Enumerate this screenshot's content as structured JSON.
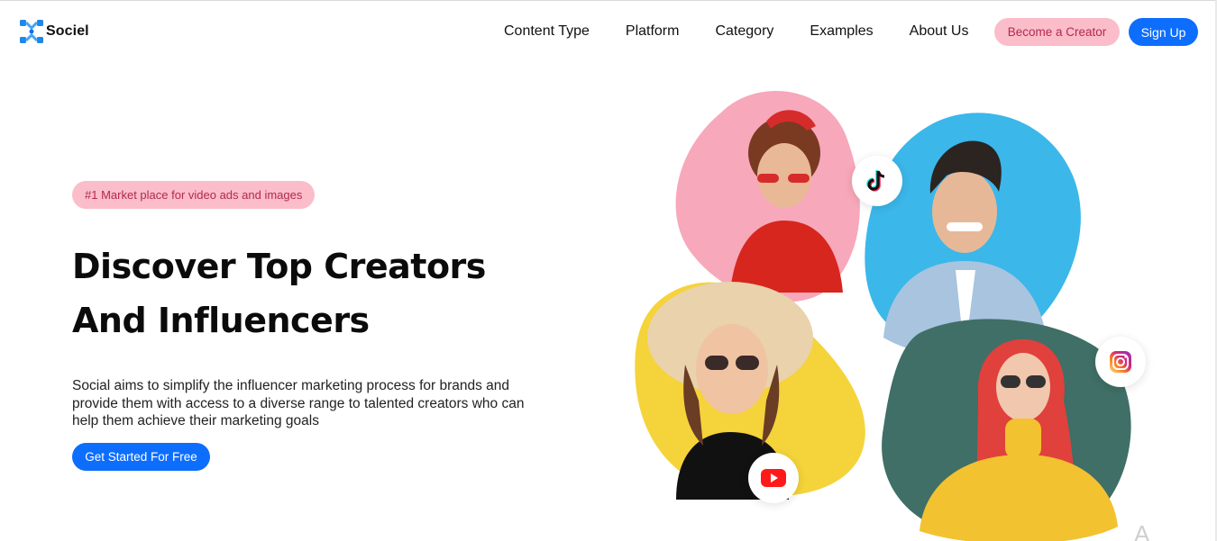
{
  "brand": {
    "name": "Sociel",
    "logo_icon": "brand-logo-icon",
    "accent": "#0d6efd",
    "pink": "#fbbdc9"
  },
  "nav": {
    "items": [
      {
        "label": "Content Type"
      },
      {
        "label": "Platform"
      },
      {
        "label": "Category"
      },
      {
        "label": "Examples"
      },
      {
        "label": "About Us"
      }
    ],
    "become_creator_label": "Become a Creator",
    "signup_label": "Sign Up"
  },
  "hero": {
    "badge": "#1 Market place for video ads and images",
    "headline_line1": "Discover Top Creators",
    "headline_line2": "And Influencers",
    "description": "Social aims to simplify the influencer marketing process for brands and provide them with access to a diverse range to talented creators who can help them achieve their marketing goals",
    "cta_label": "Get Started For Free"
  },
  "collage": {
    "blobs": [
      {
        "name": "creator-photo-pink",
        "color": "#f7a8ba"
      },
      {
        "name": "creator-photo-blue",
        "color": "#3bb7ea"
      },
      {
        "name": "creator-photo-yellow",
        "color": "#f5d33a"
      },
      {
        "name": "creator-photo-teal",
        "color": "#3f6f66"
      }
    ],
    "platform_icons": [
      "tiktok-icon",
      "youtube-icon",
      "instagram-icon"
    ]
  },
  "watermark": "A"
}
